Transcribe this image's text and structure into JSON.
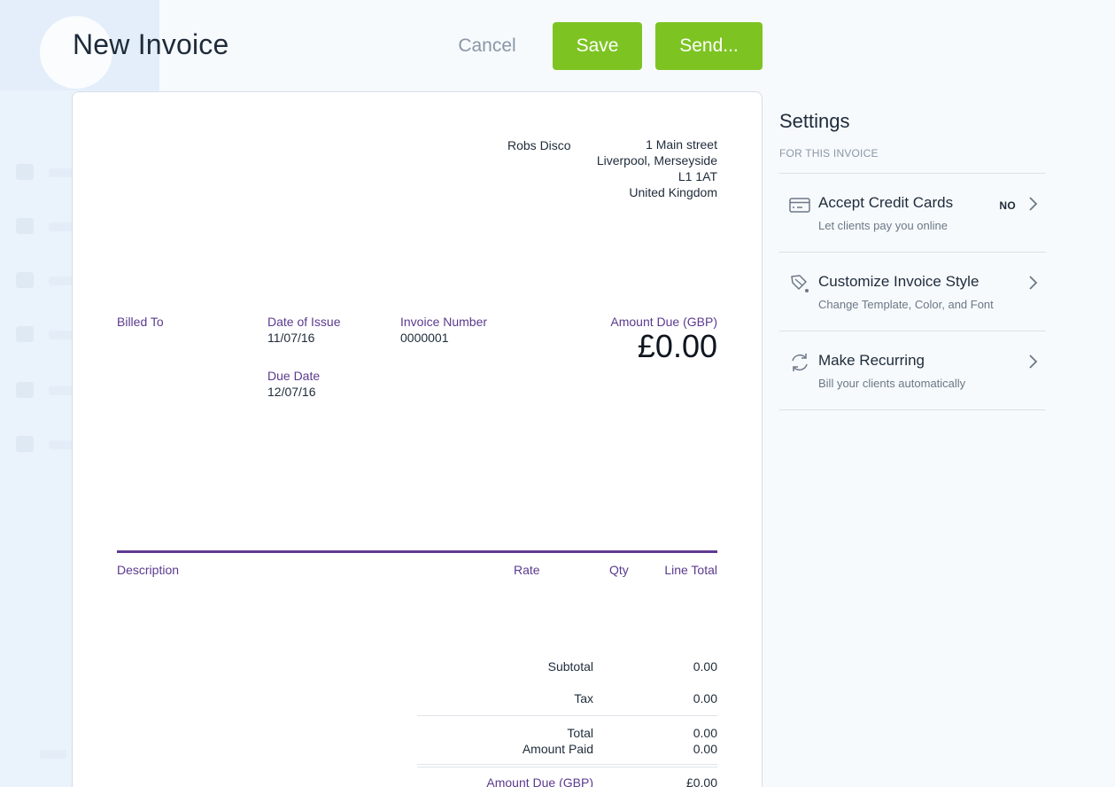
{
  "header": {
    "title": "New Invoice",
    "cancel_label": "Cancel",
    "save_label": "Save",
    "send_label": "Send..."
  },
  "invoice": {
    "company_name": "Robs Disco",
    "address": [
      "1 Main street",
      "Liverpool, Merseyside",
      "L1 1AT",
      "United Kingdom"
    ],
    "billed_to_label": "Billed To",
    "date_of_issue_label": "Date of Issue",
    "date_of_issue": "11/07/16",
    "due_date_label": "Due Date",
    "due_date": "12/07/16",
    "invoice_number_label": "Invoice Number",
    "invoice_number": "0000001",
    "amount_due_label": "Amount Due (GBP)",
    "amount_due": "£0.00",
    "columns": {
      "description": "Description",
      "rate": "Rate",
      "qty": "Qty",
      "line_total": "Line Total"
    },
    "summary": {
      "subtotal_label": "Subtotal",
      "subtotal": "0.00",
      "tax_label": "Tax",
      "tax": "0.00",
      "total_label": "Total",
      "total": "0.00",
      "amount_paid_label": "Amount Paid",
      "amount_paid": "0.00",
      "amount_due_label": "Amount Due (GBP)",
      "amount_due": "£0.00"
    }
  },
  "settings": {
    "title": "Settings",
    "subtitle": "FOR THIS INVOICE",
    "items": [
      {
        "title": "Accept Credit Cards",
        "desc": "Let clients pay you online",
        "badge": "NO",
        "icon": "credit-card-icon"
      },
      {
        "title": "Customize Invoice Style",
        "desc": "Change Template, Color, and Font",
        "icon": "paint-brush-icon"
      },
      {
        "title": "Make Recurring",
        "desc": "Bill your clients automatically",
        "icon": "recurring-icon"
      }
    ]
  },
  "colors": {
    "accent_green": "#7dc423",
    "accent_purple": "#5e3a91",
    "background": "#f7fafd"
  }
}
